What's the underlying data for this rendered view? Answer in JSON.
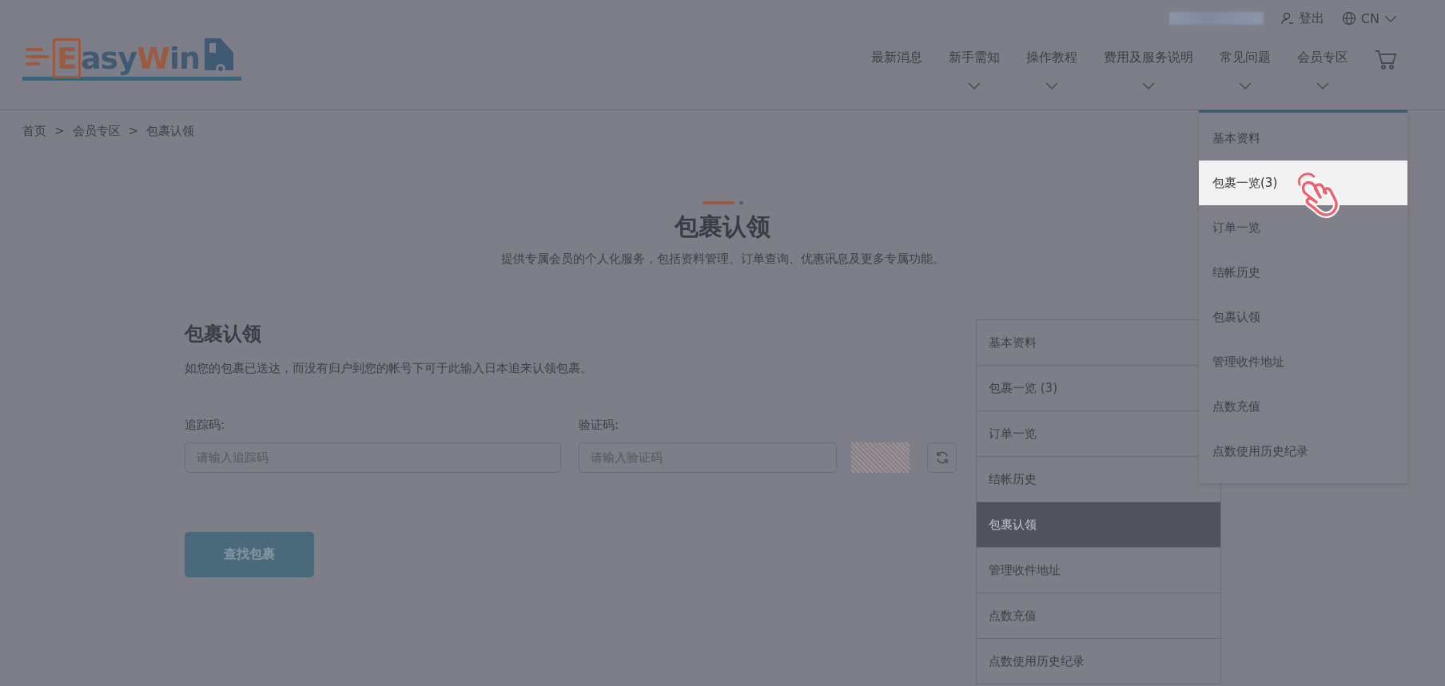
{
  "header": {
    "logo_parts": [
      {
        "text": "E",
        "color": "#9c5a40"
      },
      {
        "text": "asy",
        "color": "#3f5a72"
      },
      {
        "text": "W",
        "color": "#9c5a40"
      },
      {
        "text": "in",
        "color": "#3f5a72"
      }
    ],
    "top_links": [
      {
        "kind": "logout",
        "label": "登出"
      },
      {
        "kind": "language",
        "label": "CN"
      }
    ],
    "nav": [
      {
        "label": "最新消息",
        "has_dropdown": false
      },
      {
        "label": "新手需知",
        "has_dropdown": true
      },
      {
        "label": "操作教程",
        "has_dropdown": true
      },
      {
        "label": "费用及服务说明",
        "has_dropdown": true
      },
      {
        "label": "常见问题",
        "has_dropdown": true
      },
      {
        "label": "会员专区",
        "has_dropdown": true
      }
    ]
  },
  "breadcrumb": [
    "首页",
    "会员专区",
    "包裹认领"
  ],
  "breadcrumb_separator": ">",
  "page_title": "包裹认领",
  "page_subtitle": "提供专属会员的个人化服务，包括资料管理、订单查询、优惠讯息及更多专属功能。",
  "form": {
    "title": "包裹认领",
    "description": "如您的包裹已送达，而没有归户到您的帐号下可于此输入日本追来认领包裹。",
    "fields": [
      {
        "label": "追踪码:",
        "placeholder": "请输入追踪码"
      },
      {
        "label": "验证码:",
        "placeholder": "请输入验证码"
      }
    ],
    "submit": "查找包裹"
  },
  "side_menu": [
    {
      "label": "基本资料",
      "selected": false
    },
    {
      "label": "包裹一览 (3)",
      "selected": false
    },
    {
      "label": "订单一览",
      "selected": false
    },
    {
      "label": "结帐历史",
      "selected": false
    },
    {
      "label": "包裹认领",
      "selected": true
    },
    {
      "label": "管理收件地址",
      "selected": false
    },
    {
      "label": "点数充值",
      "selected": false
    },
    {
      "label": "点数使用历史纪录",
      "selected": false
    }
  ],
  "dropdown": [
    {
      "label": "基本资料",
      "selected": false
    },
    {
      "label": "包裹一览(3)",
      "selected": true
    },
    {
      "label": "订单一览",
      "selected": false
    },
    {
      "label": "结帐历史",
      "selected": false
    },
    {
      "label": "包裹认领",
      "selected": false
    },
    {
      "label": "管理收件地址",
      "selected": false
    },
    {
      "label": "点数充值",
      "selected": false
    },
    {
      "label": "点数使用历史纪录",
      "selected": false
    }
  ]
}
